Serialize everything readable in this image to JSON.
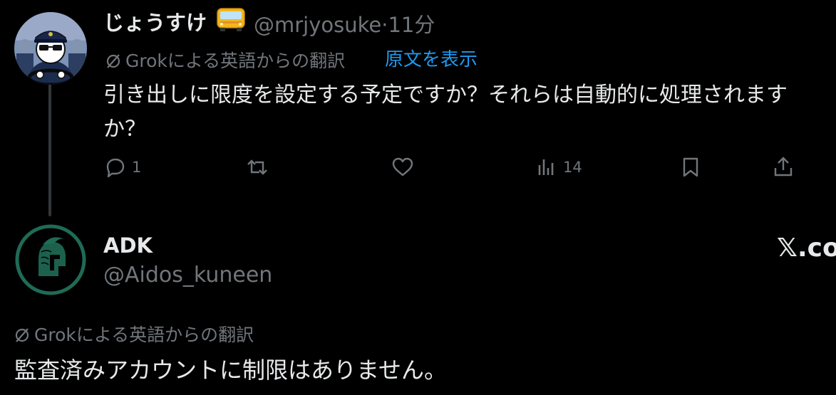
{
  "tweet1": {
    "display_name": "じょうすけ",
    "handle": "@mrjyosuke",
    "separator": "·",
    "time": "11分",
    "translation_label": "Grokによる英語からの翻訳",
    "show_original": "原文を表示",
    "text": "引き出しに限度を設定する予定ですか？それらは自動的に処理されますか？",
    "actions": {
      "reply_count": "1",
      "views_count": "14"
    }
  },
  "tweet2": {
    "display_name": "ADK",
    "handle": "@Aidos_kuneen",
    "translation_label": "Grokによる英語からの翻訳",
    "text": "監査済みアカウントに制限はありません。"
  },
  "watermark": "𝕏.co",
  "colors": {
    "background": "#000000",
    "primary_text": "#e7e9ea",
    "secondary_text": "#71767b",
    "link": "#1d9bf0",
    "avatar2_ring": "#1f6b55"
  }
}
